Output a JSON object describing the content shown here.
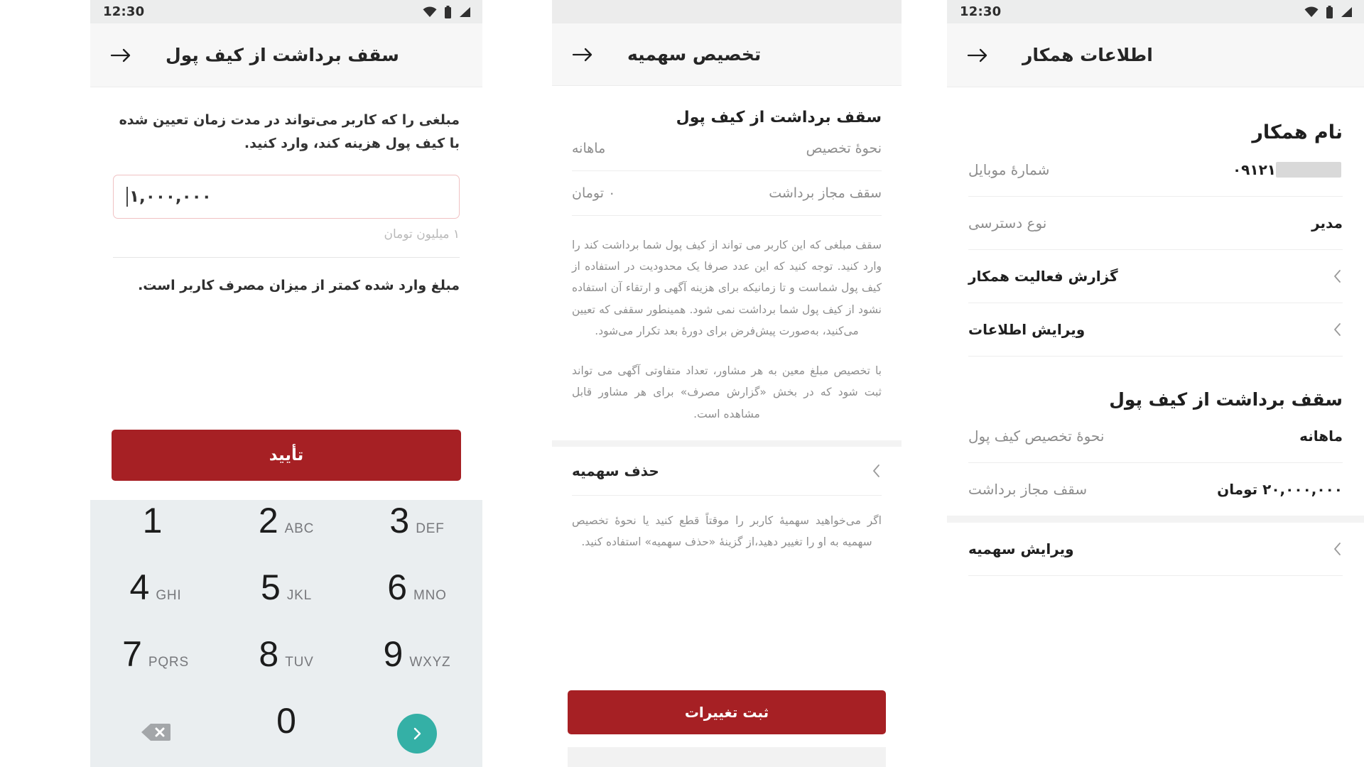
{
  "status_bar": {
    "time": "12:30",
    "icons": [
      "wifi-icon",
      "battery-icon",
      "signal-icon"
    ]
  },
  "panel1": {
    "app_bar": {
      "title": "سقف برداشت از کیف پول",
      "back_icon": "arrow-back-icon"
    },
    "description": "مبلغی را که کاربر می‌تواند در مدت زمان تعیین شده با کیف پول هزینه کند، وارد کنید.",
    "amount_input": {
      "value": "۱,۰۰۰,۰۰۰",
      "hint": "۱ میلیون تومان"
    },
    "error_text": "مبلغ وارد شده کمتر از میزان مصرف کاربر است.",
    "confirm_button": "تأیید",
    "keypad": [
      {
        "digit": "1",
        "letters": ""
      },
      {
        "digit": "2",
        "letters": "ABC"
      },
      {
        "digit": "3",
        "letters": "DEF"
      },
      {
        "digit": "4",
        "letters": "GHI"
      },
      {
        "digit": "5",
        "letters": "JKL"
      },
      {
        "digit": "6",
        "letters": "MNO"
      },
      {
        "digit": "7",
        "letters": "PQRS"
      },
      {
        "digit": "8",
        "letters": "TUV"
      },
      {
        "digit": "9",
        "letters": "WXYZ"
      },
      {
        "digit": "",
        "letters": "",
        "icon": "backspace-icon"
      },
      {
        "digit": "0",
        "letters": ""
      },
      {
        "digit": "",
        "letters": "",
        "icon": "enter-arrow-icon"
      }
    ],
    "accent_color": "#a62024",
    "enter_key_color": "#34b0a6",
    "input_border_color": "#f0c2c3"
  },
  "panel2": {
    "app_bar": {
      "title": "تخصیص سهمیه",
      "back_icon": "arrow-back-icon"
    },
    "section_title": "سقف برداشت از کیف پول",
    "rows": [
      {
        "key": "نحوهٔ تخصیص",
        "value": "ماهانه"
      },
      {
        "key": "سقف مجاز برداشت",
        "value": "۰ تومان"
      }
    ],
    "paragraph1": "سقف مبلغی که این کاربر می تواند از کیف پول شما برداشت کند را وارد کنید. توجه کنید که این عدد صرفا یک محدودیت در استفاده از کیف پول شماست و تا زمانیکه برای هزینه آگهی و ارتقاء آن استفاده نشود از کیف پول شما برداشت نمی شود. همینطور سقفی که تعیین می‌کنید، به‌صورت پیش‌فرض برای دورهٔ بعد تکرار می‌شود.",
    "paragraph2": "با تخصیص مبلغ معین به هر مشاور، تعداد متفاوتی آگهی می تواند ثبت شود که در بخش «گزارش مصرف» برای هر مشاور قابل مشاهده است.",
    "delete_row": {
      "label": "حذف سهمیه",
      "chevron": "chevron-left-icon"
    },
    "delete_note": "اگر می‌خواهید سهمیهٔ کاربر را موقتاً قطع کنید یا نحوهٔ تخصیص سهمیه به او را تغییر دهید،از گزینهٔ «حذف سهمیه» استفاده کنید.",
    "submit_button": "ثبت تغییرات",
    "accent_color": "#a62024"
  },
  "panel3": {
    "app_bar": {
      "title": "اطلاعات همکار",
      "back_icon": "arrow-back-icon"
    },
    "name_title": "نام همکار",
    "rows": [
      {
        "key": "شمارهٔ موبایل",
        "value": "۰۹۱۲۱",
        "redacted": true
      },
      {
        "key": "نوع دسترسی",
        "value": "مدیر",
        "redacted": false
      }
    ],
    "nav_rows": [
      {
        "label": "گزارش فعالیت همکار",
        "chevron": "chevron-left-icon"
      },
      {
        "label": "ویرایش اطلاعات",
        "chevron": "chevron-left-icon"
      }
    ],
    "wallet_section_title": "سقف برداشت از کیف پول",
    "wallet_rows": [
      {
        "key": "نحوهٔ تخصیص کیف پول",
        "value": "ماهانه"
      },
      {
        "key": "سقف مجاز برداشت",
        "value": "۲۰,۰۰۰,۰۰۰ تومان"
      }
    ],
    "quota_nav": {
      "label": "ویرایش سهمیه",
      "chevron": "chevron-left-icon"
    }
  }
}
